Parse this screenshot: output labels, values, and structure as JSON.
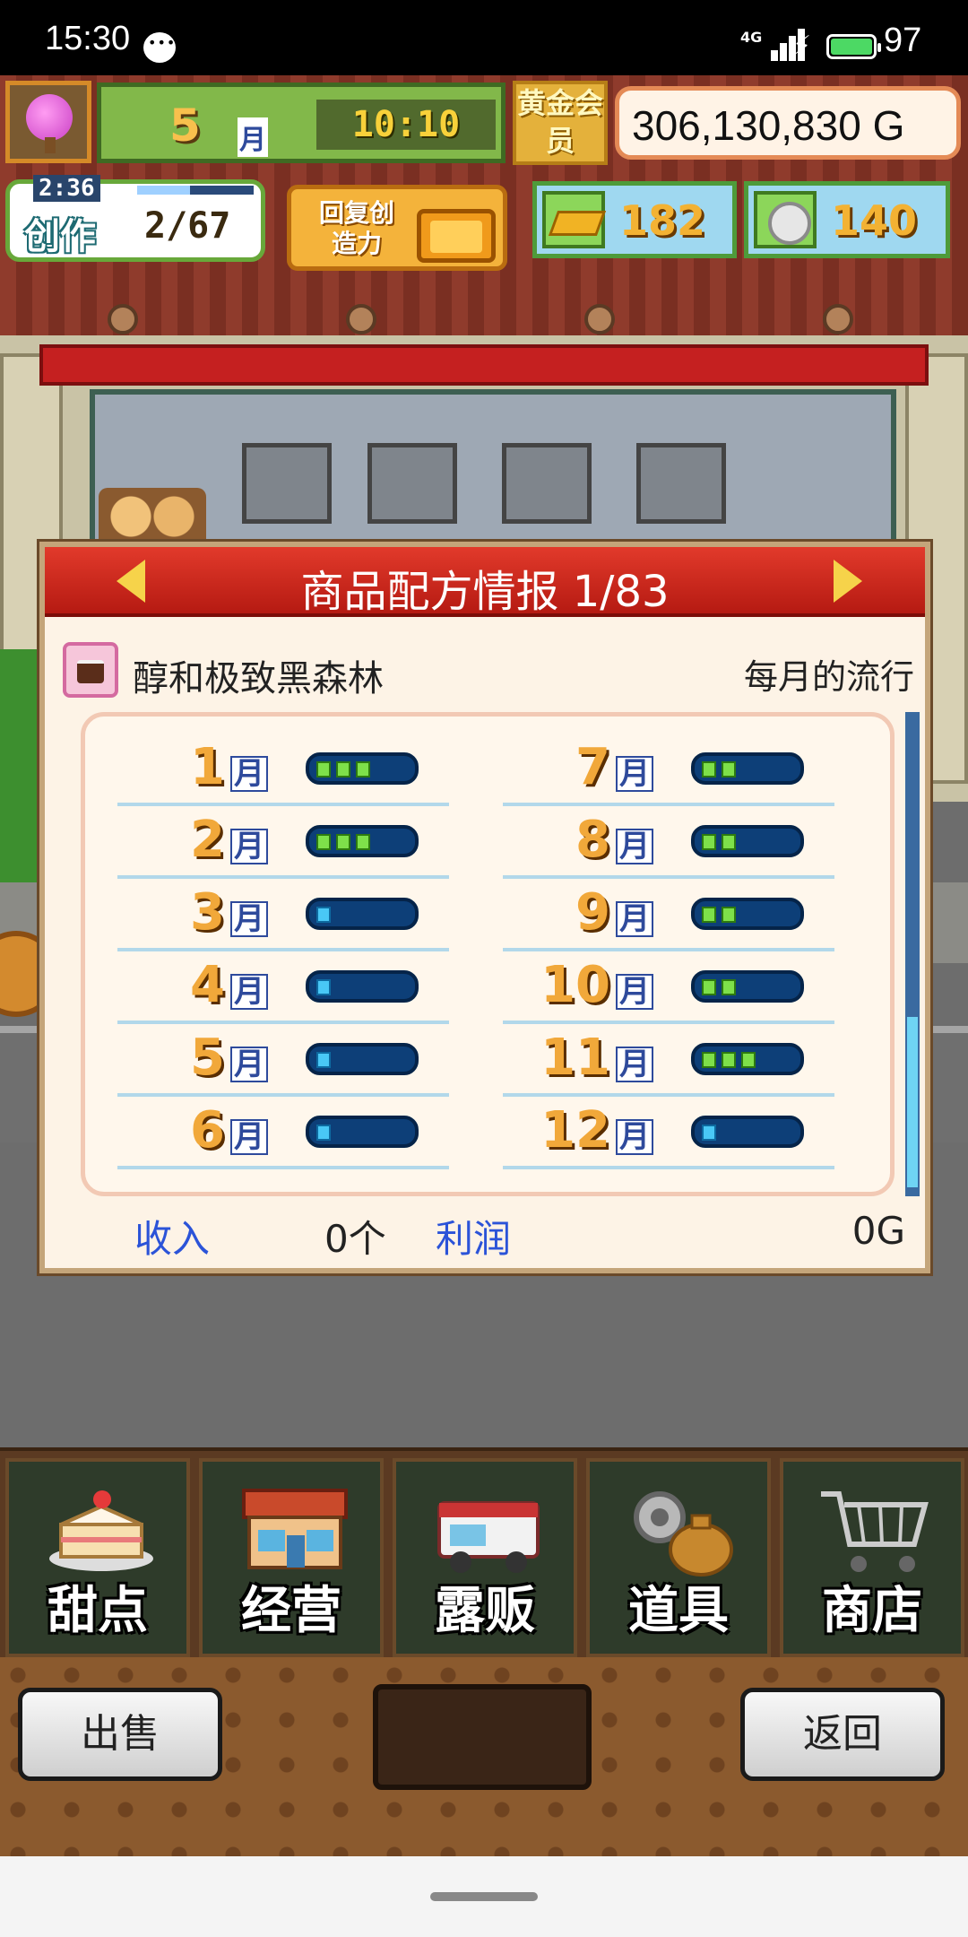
{
  "status_bar": {
    "time": "15:30",
    "network": "4G",
    "battery": "97"
  },
  "hud": {
    "month_number": "5",
    "month_label": "月",
    "clock": "10:10",
    "gold_member": "黄金会员",
    "money": "306,130,830 G",
    "create_timer": "2:36",
    "create_label": "创作",
    "create_count": "2/67",
    "restore_button": "回复创造力",
    "gold_bars": "182",
    "coins": "140"
  },
  "modal": {
    "title": "商品配方情报 1/83",
    "product_name": "醇和极致黑森林",
    "trend_label": "每月的流行",
    "months": [
      {
        "num": "1",
        "label": "月",
        "level": 3,
        "color": "green"
      },
      {
        "num": "2",
        "label": "月",
        "level": 3,
        "color": "green"
      },
      {
        "num": "3",
        "label": "月",
        "level": 1,
        "color": "blue"
      },
      {
        "num": "4",
        "label": "月",
        "level": 1,
        "color": "blue"
      },
      {
        "num": "5",
        "label": "月",
        "level": 1,
        "color": "blue"
      },
      {
        "num": "6",
        "label": "月",
        "level": 1,
        "color": "blue"
      },
      {
        "num": "7",
        "label": "月",
        "level": 2,
        "color": "green"
      },
      {
        "num": "8",
        "label": "月",
        "level": 2,
        "color": "green"
      },
      {
        "num": "9",
        "label": "月",
        "level": 2,
        "color": "green"
      },
      {
        "num": "10",
        "label": "月",
        "level": 2,
        "color": "green"
      },
      {
        "num": "11",
        "label": "月",
        "level": 3,
        "color": "green"
      },
      {
        "num": "12",
        "label": "月",
        "level": 1,
        "color": "blue"
      }
    ],
    "income_label": "收入",
    "income_value": "0个",
    "profit_label": "利润",
    "profit_value": "0G"
  },
  "nav": [
    {
      "label": "甜点",
      "icon": "cake-icon"
    },
    {
      "label": "经营",
      "icon": "store-icon"
    },
    {
      "label": "露贩",
      "icon": "food-truck-icon"
    },
    {
      "label": "道具",
      "icon": "items-icon"
    },
    {
      "label": "商店",
      "icon": "cart-icon"
    }
  ],
  "buttons": {
    "sell": "出售",
    "back": "返回"
  },
  "colors": {
    "header_red": "#c8231a",
    "link_blue": "#2b53d8",
    "gold_text": "#f3b233"
  }
}
